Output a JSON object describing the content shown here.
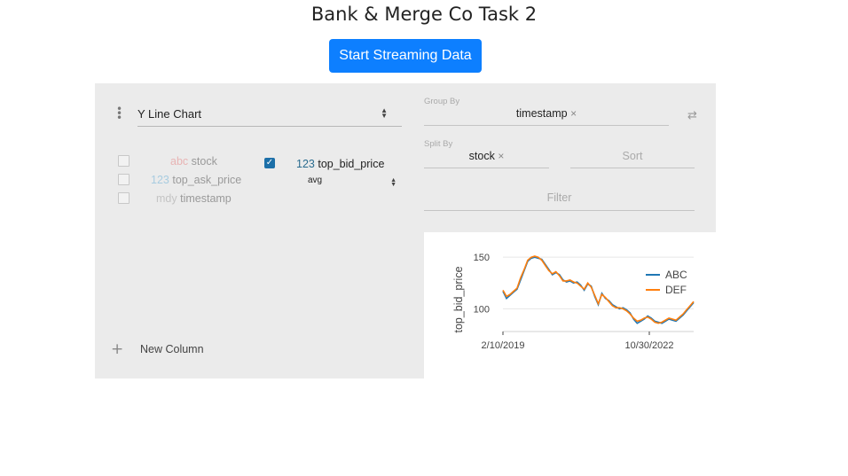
{
  "page": {
    "title": "Bank & Merge Co Task 2"
  },
  "toolbar": {
    "start_label": "Start Streaming Data"
  },
  "config": {
    "plugin": "Y Line Chart",
    "inactive_columns": [
      {
        "type_label": "abc",
        "name": "stock"
      },
      {
        "type_label": "123",
        "name": "top_ask_price"
      },
      {
        "type_label": "mdy",
        "name": "timestamp"
      }
    ],
    "active_column": {
      "type_label": "123",
      "name": "top_bid_price",
      "aggregate": "avg"
    },
    "new_column_label": "New Column",
    "new_column_icon": "+",
    "group_by": {
      "label": "Group By",
      "value": "timestamp"
    },
    "split_by": {
      "label": "Split By",
      "value": "stock"
    },
    "sort_placeholder": "Sort",
    "filter_placeholder": "Filter",
    "remove_icon": "×",
    "swap_icon": "⇄",
    "check_icon": "✓"
  },
  "chart_data": {
    "type": "line",
    "ylabel": "top_bid_price",
    "xlabel": "",
    "x_ticks": [
      "2/10/2019",
      "10/30/2022"
    ],
    "y_ticks": [
      100,
      150
    ],
    "ylim": [
      78,
      157
    ],
    "legend_position": "top-right",
    "x_range": [
      "2019-02-10",
      "2023-06-30"
    ],
    "series": [
      {
        "name": "ABC",
        "color": "#1f77b4",
        "values": [
          117,
          110,
          113,
          116,
          119,
          128,
          137,
          146,
          149,
          150,
          149,
          148,
          143,
          138,
          133,
          135,
          133,
          128,
          126,
          127,
          125,
          126,
          123,
          118,
          124,
          122,
          112,
          104,
          115,
          110,
          108,
          104,
          102,
          100,
          101,
          99,
          96,
          90,
          86,
          88,
          90,
          93,
          91,
          88,
          87,
          86,
          88,
          90,
          89,
          88,
          91,
          94,
          98,
          102,
          106
        ]
      },
      {
        "name": "DEF",
        "color": "#ff7f0e",
        "values": [
          118,
          112,
          114,
          117,
          120,
          130,
          138,
          147,
          150,
          151,
          150,
          147,
          142,
          137,
          134,
          136,
          132,
          127,
          127,
          128,
          126,
          125,
          122,
          119,
          125,
          121,
          113,
          105,
          114,
          111,
          107,
          103,
          101,
          101,
          100,
          98,
          95,
          91,
          88,
          89,
          91,
          92,
          90,
          87,
          86,
          87,
          89,
          91,
          90,
          89,
          92,
          95,
          99,
          103,
          107
        ]
      }
    ]
  }
}
